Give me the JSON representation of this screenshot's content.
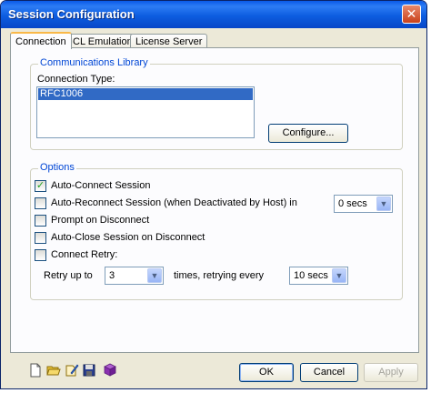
{
  "window": {
    "title": "Session Configuration",
    "close_glyph": "✕"
  },
  "tabs": [
    {
      "label": "Connection",
      "active": true
    },
    {
      "label": "ICL Emulation",
      "active": false
    },
    {
      "label": "License Server",
      "active": false
    }
  ],
  "comm_library": {
    "legend": "Communications Library",
    "connection_type_label": "Connection Type:",
    "items": [
      "RFC1006"
    ],
    "selected": "RFC1006",
    "configure_button": "Configure..."
  },
  "options": {
    "legend": "Options",
    "auto_connect": {
      "label": "Auto-Connect Session",
      "checked": true,
      "mark": "✓"
    },
    "auto_reconnect": {
      "label": "Auto-Reconnect Session (when Deactivated by Host) in",
      "checked": false,
      "select_value": "0 secs"
    },
    "prompt_disconnect": {
      "label": "Prompt on Disconnect",
      "checked": false
    },
    "auto_close": {
      "label": "Auto-Close Session on Disconnect",
      "checked": false
    },
    "connect_retry": {
      "label": "Connect Retry:",
      "checked": false
    },
    "retry_prefix": "Retry up to",
    "retry_count": "3",
    "retry_middle": "times, retrying every",
    "retry_interval": "10 secs"
  },
  "buttons": {
    "ok": "OK",
    "cancel": "Cancel",
    "apply": "Apply"
  },
  "toolbar": {
    "icons": [
      "new-document-icon",
      "open-folder-icon",
      "edit-icon",
      "save-disk-icon",
      "book-icon"
    ]
  },
  "colors": {
    "title_bar": "#0a5ae8",
    "legend_text": "#0046d5",
    "selection": "#316ac5",
    "dialog_bg": "#ece9d8"
  }
}
